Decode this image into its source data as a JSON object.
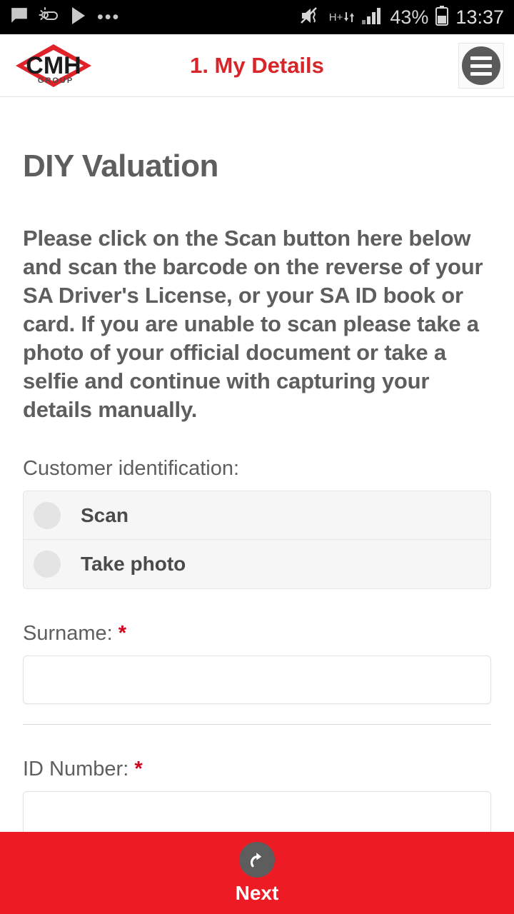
{
  "statusbar": {
    "icons_left": [
      "message-icon",
      "weather-icon",
      "play-store-icon",
      "more-dots-icon"
    ],
    "network_type": "H+",
    "battery_percent": "43%",
    "clock": "13:37",
    "icons_right": [
      "volume-mute-icon",
      "data-transfer-icon",
      "signal-bars-icon",
      "battery-icon"
    ]
  },
  "header": {
    "logo_main": "CMH",
    "logo_sub": "GROUP",
    "title": "1. My Details",
    "menu_icon": "hamburger-menu-icon",
    "title_color": "#d8252a"
  },
  "main": {
    "heading": "DIY Valuation",
    "paragraph": "Please click on the Scan button here below and scan the barcode on the reverse of your SA Driver's License, or your SA ID book or card. If you are unable to scan please take a photo of your official document or take a selfie and continue with capturing your details manually.",
    "identification": {
      "label": "Customer identification:",
      "options": [
        {
          "label": "Scan",
          "selected": false
        },
        {
          "label": "Take photo",
          "selected": false
        }
      ]
    },
    "fields": [
      {
        "label": "Surname:",
        "required_marker": "*",
        "value": "",
        "placeholder": ""
      },
      {
        "label": "ID Number:",
        "required_marker": "*",
        "value": "",
        "placeholder": ""
      }
    ]
  },
  "footer": {
    "next_label": "Next",
    "next_icon": "forward-arrow-icon",
    "background_color": "#ed1c24"
  }
}
